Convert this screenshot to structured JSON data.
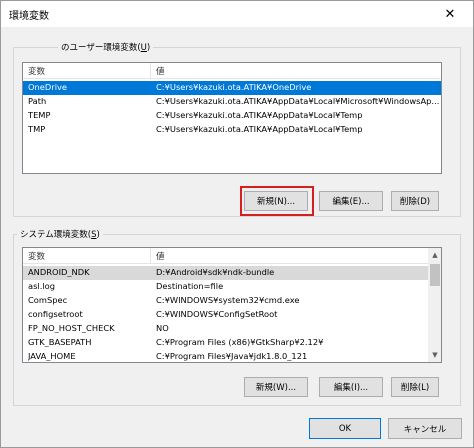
{
  "window": {
    "title": "環境変数",
    "close_glyph": "✕"
  },
  "user_section": {
    "label_prefix": "のユーザー環境変数(",
    "label_key": "U",
    "label_suffix": ")",
    "columns": [
      "変数",
      "値"
    ],
    "rows": [
      {
        "name": "OneDrive",
        "value": "C:¥Users¥kazuki.ota.ATIKA¥OneDrive",
        "selected": true
      },
      {
        "name": "Path",
        "value": "C:¥Users¥kazuki.ota.ATIKA¥AppData¥Local¥Microsoft¥WindowsAp..."
      },
      {
        "name": "TEMP",
        "value": "C:¥Users¥kazuki.ota.ATIKA¥AppData¥Local¥Temp"
      },
      {
        "name": "TMP",
        "value": "C:¥Users¥kazuki.ota.ATIKA¥AppData¥Local¥Temp"
      }
    ],
    "buttons": {
      "new": "新規(N)...",
      "edit": "編集(E)...",
      "delete": "削除(D)"
    }
  },
  "system_section": {
    "label_prefix": "システム環境変数(",
    "label_key": "S",
    "label_suffix": ")",
    "columns": [
      "変数",
      "値"
    ],
    "rows": [
      {
        "name": "ANDROID_NDK",
        "value": "D:¥Android¥sdk¥ndk-bundle",
        "selected": true
      },
      {
        "name": "asl.log",
        "value": "Destination=file"
      },
      {
        "name": "ComSpec",
        "value": "C:¥WINDOWS¥system32¥cmd.exe"
      },
      {
        "name": "configsetroot",
        "value": "C:¥WINDOWS¥ConfigSetRoot"
      },
      {
        "name": "FP_NO_HOST_CHECK",
        "value": "NO"
      },
      {
        "name": "GTK_BASEPATH",
        "value": "C:¥Program Files (x86)¥GtkSharp¥2.12¥"
      },
      {
        "name": "JAVA_HOME",
        "value": "C:¥Program Files¥Java¥jdk1.8.0_121"
      }
    ],
    "buttons": {
      "new": "新規(W)...",
      "edit": "編集(I)...",
      "delete": "削除(L)"
    }
  },
  "footer": {
    "ok": "OK",
    "cancel": "キャンセル"
  },
  "highlight_color": "#d62020",
  "selection_color": "#0078d7"
}
